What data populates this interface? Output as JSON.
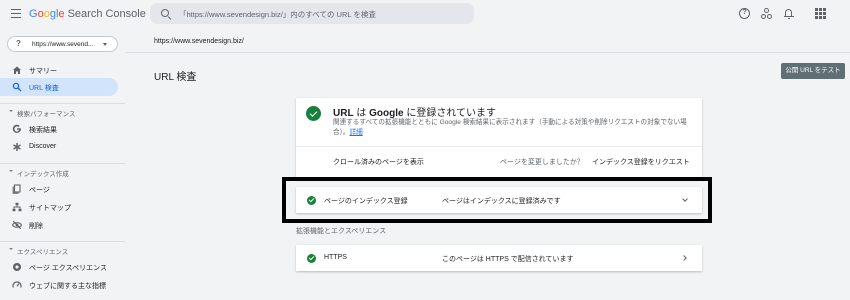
{
  "header": {
    "logo_google": [
      "G",
      "o",
      "o",
      "g",
      "l",
      "e"
    ],
    "logo_rest": "Search Console",
    "search_placeholder": "「https://www.sevendesign.biz/」内のすべての URL を検査",
    "help_icon": "help-icon",
    "people_icon": "manage-users-icon",
    "bell_icon": "notifications-icon",
    "apps_icon": "apps-grid-icon",
    "help_glyph": "?"
  },
  "sidebar": {
    "property": {
      "icon_glyph": "?",
      "label": "https://www.sevend..."
    },
    "top_items": [
      {
        "label": "サマリー",
        "icon": "home-icon"
      },
      {
        "label": "URL 検査",
        "icon": "search-icon",
        "active": true
      }
    ],
    "sections": [
      {
        "label": "検索パフォーマンス",
        "items": [
          {
            "label": "検索結果",
            "icon": "google-g-icon"
          },
          {
            "label": "Discover",
            "icon": "asterisk-icon"
          }
        ]
      },
      {
        "label": "インデックス作成",
        "items": [
          {
            "label": "ページ",
            "icon": "pages-icon"
          },
          {
            "label": "サイトマップ",
            "icon": "sitemap-icon"
          },
          {
            "label": "削除",
            "icon": "removals-icon"
          }
        ]
      },
      {
        "label": "エクスペリエンス",
        "items": [
          {
            "label": "ページ エクスペリエンス",
            "icon": "page-experience-icon"
          },
          {
            "label": "ウェブに関する主な指標",
            "icon": "speedometer-icon"
          }
        ]
      }
    ]
  },
  "main": {
    "breadcrumb": "https://www.sevendesign.biz/",
    "title": "URL 検査",
    "test_button": "公開 URL をテスト",
    "status": {
      "title_pre": "URL",
      "title_mid": " は ",
      "title_brand": "Google",
      "title_post": " に登録されています",
      "desc": "関連するすべての拡張機能とともに Google 検索結果に表示されます（手動による対策や削除リクエストの対象でない場合）。",
      "desc_link": "詳細",
      "crawled_link": "クロール済みのページを表示",
      "changed_question": "ページを変更しましたか？",
      "request_indexing": "インデックス登録をリクエスト"
    },
    "index_row": {
      "label": "ページのインデックス登録",
      "value": "ページはインデックスに登録済みです"
    },
    "ext_heading": "拡張機能とエクスペリエンス",
    "https_row": {
      "label": "HTTPS",
      "value": "このページは HTTPS で配信されています"
    },
    "colors": {
      "success": "#188038",
      "active_nav_bg": "#d2e3fc",
      "active_nav_text": "#1967d2",
      "test_btn_bg": "#5f6f73",
      "highlight_border": "#000000"
    }
  }
}
